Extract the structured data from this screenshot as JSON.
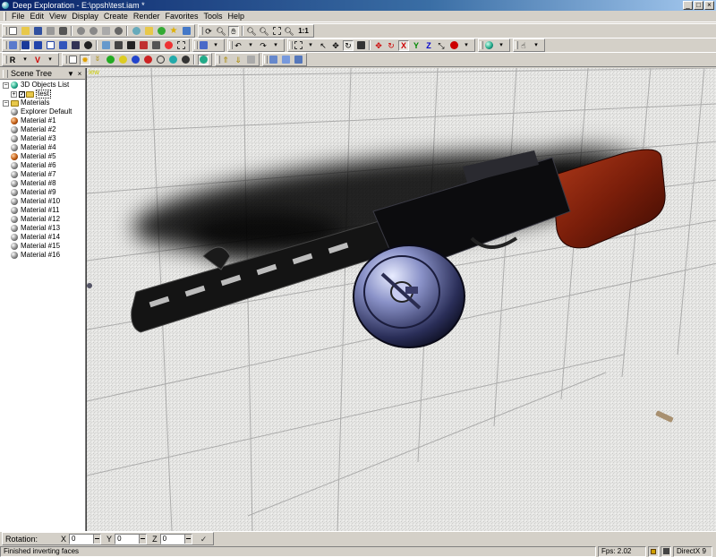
{
  "window": {
    "title": "Deep Exploration - E:\\ppsh\\test.iam *",
    "min_symbol": "_",
    "max_symbol": "□",
    "close_symbol": "×"
  },
  "menu": [
    "File",
    "Edit",
    "View",
    "Display",
    "Create",
    "Render",
    "Favorites",
    "Tools",
    "Help"
  ],
  "toolbar": {
    "zoom_label": "1:1",
    "axis_x": "X",
    "axis_y": "Y",
    "axis_z": "Z"
  },
  "scene_tree": {
    "title": "Scene Tree",
    "pin_symbol": "▼",
    "close_symbol": "×",
    "objects_list_label": "3D Objects List",
    "object_name": "test",
    "materials_label": "Materials",
    "materials": [
      {
        "name": "Explorer Default",
        "color": "gray"
      },
      {
        "name": "Material #1",
        "color": "orange"
      },
      {
        "name": "Material #2",
        "color": "gray"
      },
      {
        "name": "Material #3",
        "color": "gray"
      },
      {
        "name": "Material #4",
        "color": "gray"
      },
      {
        "name": "Material #5",
        "color": "orange"
      },
      {
        "name": "Material #6",
        "color": "gray"
      },
      {
        "name": "Material #7",
        "color": "gray"
      },
      {
        "name": "Material #8",
        "color": "gray"
      },
      {
        "name": "Material #9",
        "color": "gray"
      },
      {
        "name": "Material #10",
        "color": "gray"
      },
      {
        "name": "Material #11",
        "color": "gray"
      },
      {
        "name": "Material #12",
        "color": "gray"
      },
      {
        "name": "Material #13",
        "color": "gray"
      },
      {
        "name": "Material #14",
        "color": "gray"
      },
      {
        "name": "Material #15",
        "color": "gray"
      },
      {
        "name": "Material #16",
        "color": "gray"
      }
    ]
  },
  "viewport": {
    "label": "iew"
  },
  "rotation": {
    "label": "Rotation:",
    "x_label": "X",
    "y_label": "Y",
    "z_label": "Z",
    "x_value": "0",
    "y_value": "0",
    "z_value": "0",
    "apply_symbol": "✓"
  },
  "status": {
    "message": "Finished inverting faces",
    "fps": "Fps: 2.02",
    "renderer": "DirectX 9"
  }
}
